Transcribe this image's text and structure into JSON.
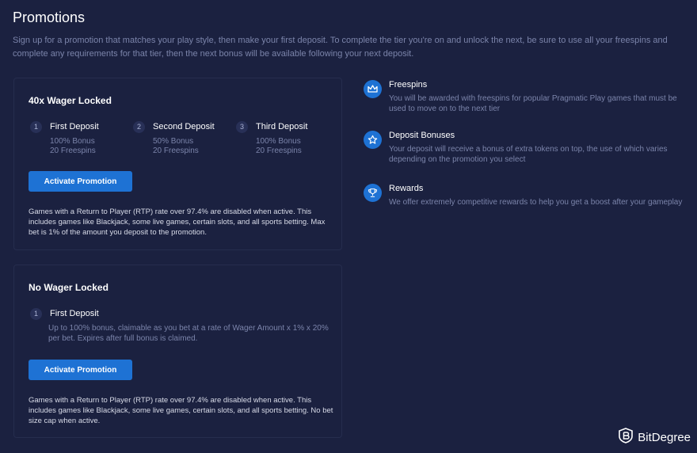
{
  "page": {
    "title": "Promotions",
    "intro": "Sign up for a promotion that matches your play style, then make your first deposit. To complete the tier you're on and unlock the next, be sure to use all your freespins and complete any requirements for that tier, then the next bonus will be available following your next deposit."
  },
  "cards": [
    {
      "title": "40x Wager Locked",
      "tiers": [
        {
          "num": "1",
          "title": "First Deposit",
          "line1": "100% Bonus",
          "line2": "20 Freespins"
        },
        {
          "num": "2",
          "title": "Second Deposit",
          "line1": "50% Bonus",
          "line2": "20 Freespins"
        },
        {
          "num": "3",
          "title": "Third Deposit",
          "line1": "100% Bonus",
          "line2": "20 Freespins"
        }
      ],
      "button": "Activate Promotion",
      "note": "Games with a Return to Player (RTP) rate over 97.4% are disabled when active. This includes games like Blackjack, some live games, certain slots, and all sports betting. Max bet is 1% of the amount you deposit to the promotion."
    },
    {
      "title": "No Wager Locked",
      "tiers": [
        {
          "num": "1",
          "title": "First Deposit",
          "text": "Up to 100% bonus, claimable as you bet at a rate of Wager Amount x 1% x 20% per bet. Expires after full bonus is claimed."
        }
      ],
      "button": "Activate Promotion",
      "note": "Games with a Return to Player (RTP) rate over 97.4% are disabled when active. This includes games like Blackjack, some live games, certain slots, and all sports betting. No bet size cap when active."
    }
  ],
  "features": [
    {
      "icon": "crown-icon",
      "title": "Freespins",
      "desc": "You will be awarded with freespins for popular Pragmatic Play games that must be used to move on to the next tier"
    },
    {
      "icon": "star-icon",
      "title": "Deposit Bonuses",
      "desc": "Your deposit will receive a bonus of extra tokens on top, the use of which varies depending on the promotion you select"
    },
    {
      "icon": "trophy-icon",
      "title": "Rewards",
      "desc": "We offer extremely competitive rewards to help you get a boost after your gameplay"
    }
  ],
  "watermark": "BitDegree",
  "colors": {
    "background": "#1b2140",
    "accent": "#1e72d4",
    "muted": "#7b84aa"
  }
}
